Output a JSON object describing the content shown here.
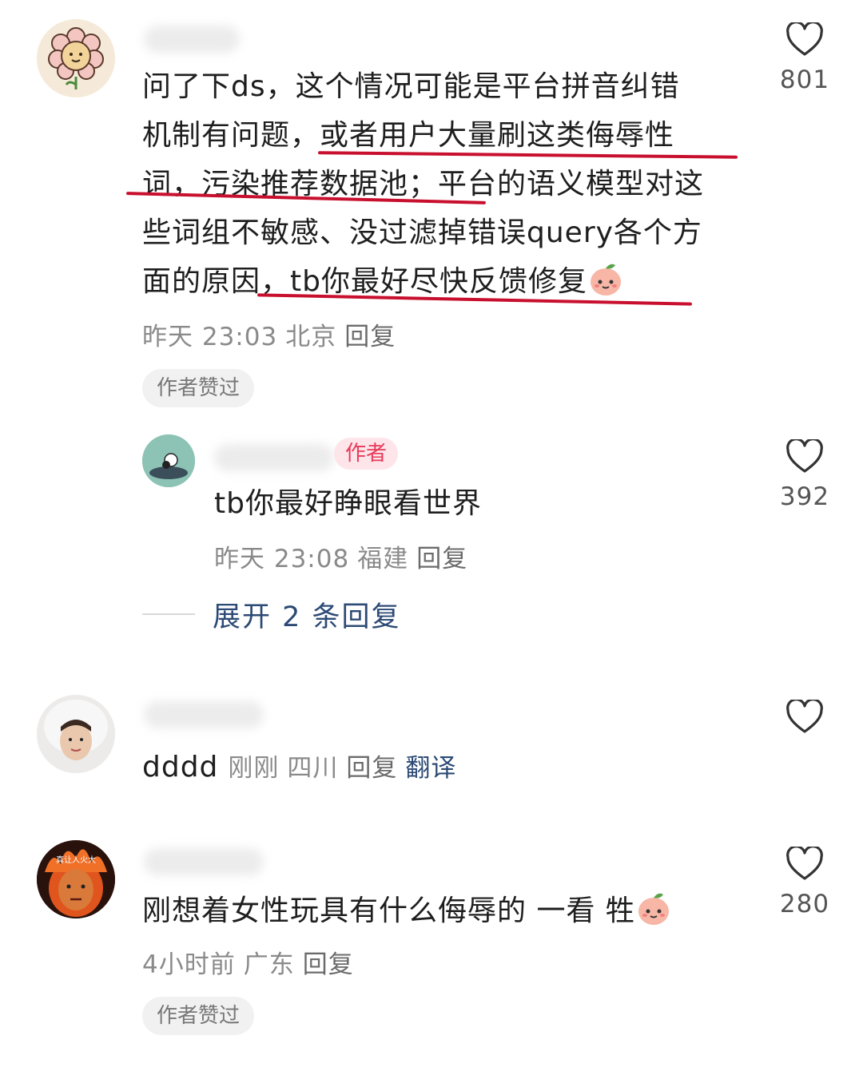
{
  "comments": [
    {
      "text_lines": [
        "问了下ds，这个情况可能是平台拼音纠错",
        "机制有问题，或者用户大量刷这类侮辱性",
        "词，污染推荐数据池；平台的语义模型对这",
        "些词组不敏感、没过滤掉错误query各个方",
        "面的原因，tb你最好尽快反馈修复"
      ],
      "time": "昨天 23:03",
      "location": "北京",
      "reply_label": "回复",
      "chip": "作者赞过",
      "likes": "801"
    },
    {
      "author_tag": "作者",
      "text": "tb你最好睁眼看世界",
      "time": "昨天 23:08",
      "location": "福建",
      "reply_label": "回复",
      "likes": "392",
      "expand": "展开 2 条回复"
    },
    {
      "text": "dddd",
      "time": "刚刚",
      "location": "四川",
      "reply_label": "回复",
      "translate": "翻译"
    },
    {
      "text": "刚想着女性玩具有什么侮辱的 一看 牲",
      "avatar_text": "真让人火大",
      "time": "4小时前",
      "location": "广东",
      "reply_label": "回复",
      "chip": "作者赞过",
      "likes": "280"
    }
  ],
  "colors": {
    "underline": "#c8102e",
    "link": "#2c4a75",
    "meta": "#8a8a8a",
    "author_tag_bg": "#fde5e9",
    "author_tag_fg": "#e83a5a"
  },
  "icons": [
    "heart-outline-icon",
    "peach-emoji-icon"
  ]
}
